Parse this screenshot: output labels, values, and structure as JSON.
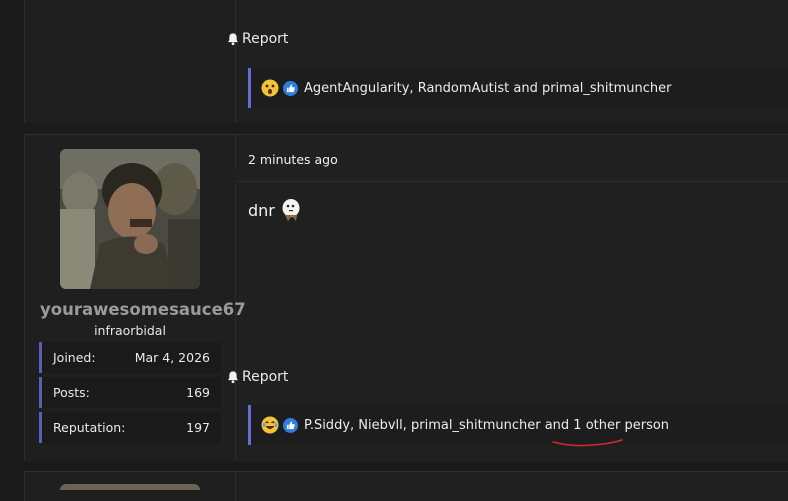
{
  "post_top": {
    "report_label": "Report",
    "reactions_text": "AgentAngularity, RandomAutist and primal_shitmuncher",
    "reaction_icons": [
      "astonished-face-icon",
      "thumbs-up-icon"
    ]
  },
  "post_main": {
    "timestamp": "2 minutes ago",
    "message_text": "dnr",
    "report_label": "Report",
    "reactions_text": "P.Siddy, Niebvll, primal_shitmuncher and 1 other person",
    "reaction_icons": [
      "laughing-face-icon",
      "thumbs-up-icon"
    ],
    "user": {
      "username": "yourawesomesauce67",
      "user_title": "infraorbidal",
      "stats": [
        {
          "label": "Joined:",
          "value": "Mar 4, 2026"
        },
        {
          "label": "Posts:",
          "value": "169"
        },
        {
          "label": "Reputation:",
          "value": "197"
        }
      ]
    }
  },
  "colors": {
    "accent_bar": "#6a6cd3",
    "like_blue": "#2e7fe0",
    "underline_red": "#d42a2a"
  }
}
